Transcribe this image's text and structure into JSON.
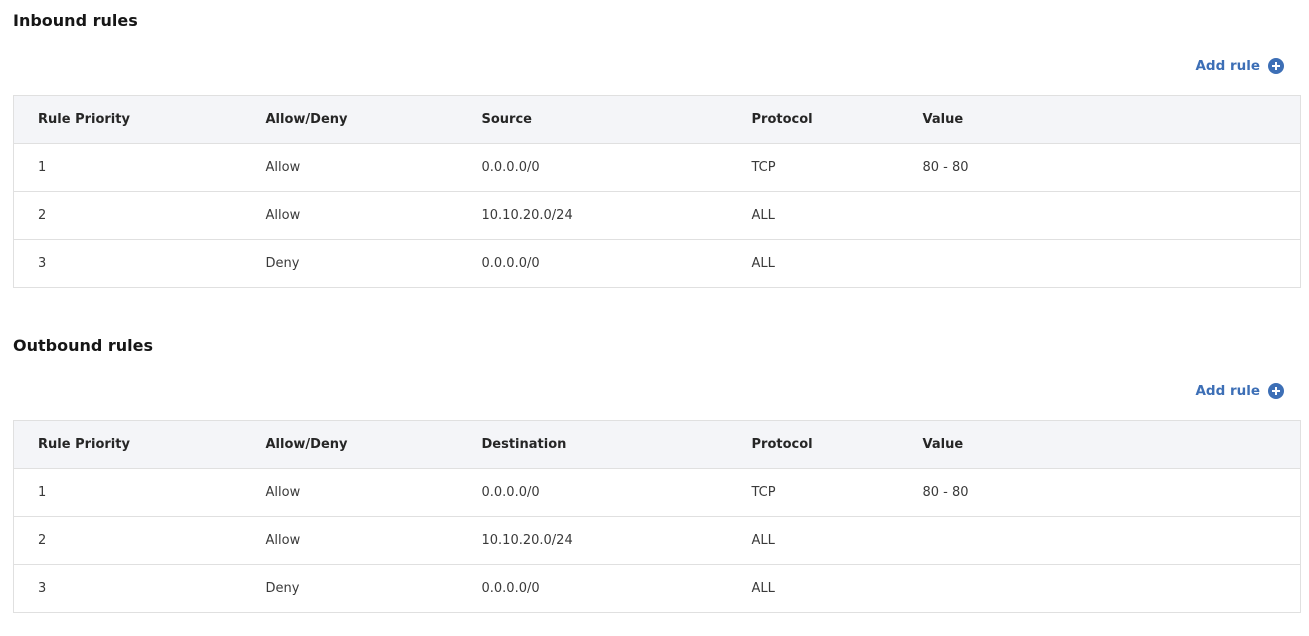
{
  "inbound": {
    "title": "Inbound rules",
    "add_rule_label": "Add rule",
    "add_icon": "plus-circle-icon",
    "columns": [
      "Rule Priority",
      "Allow/Deny",
      "Source",
      "Protocol",
      "Value"
    ],
    "rows": [
      [
        "1",
        "Allow",
        "0.0.0.0/0",
        "TCP",
        "80 - 80"
      ],
      [
        "2",
        "Allow",
        "10.10.20.0/24",
        "ALL",
        ""
      ],
      [
        "3",
        "Deny",
        "0.0.0.0/0",
        "ALL",
        ""
      ]
    ]
  },
  "outbound": {
    "title": "Outbound rules",
    "add_rule_label": "Add rule",
    "add_icon": "plus-circle-icon",
    "columns": [
      "Rule Priority",
      "Allow/Deny",
      "Destination",
      "Protocol",
      "Value"
    ],
    "rows": [
      [
        "1",
        "Allow",
        "0.0.0.0/0",
        "TCP",
        "80 - 80"
      ],
      [
        "2",
        "Allow",
        "10.10.20.0/24",
        "ALL",
        ""
      ],
      [
        "3",
        "Deny",
        "0.0.0.0/0",
        "ALL",
        ""
      ]
    ]
  },
  "colors": {
    "accent": "#3d6fb6",
    "header_bg": "#f4f5f8",
    "border": "#e0e0e0"
  }
}
